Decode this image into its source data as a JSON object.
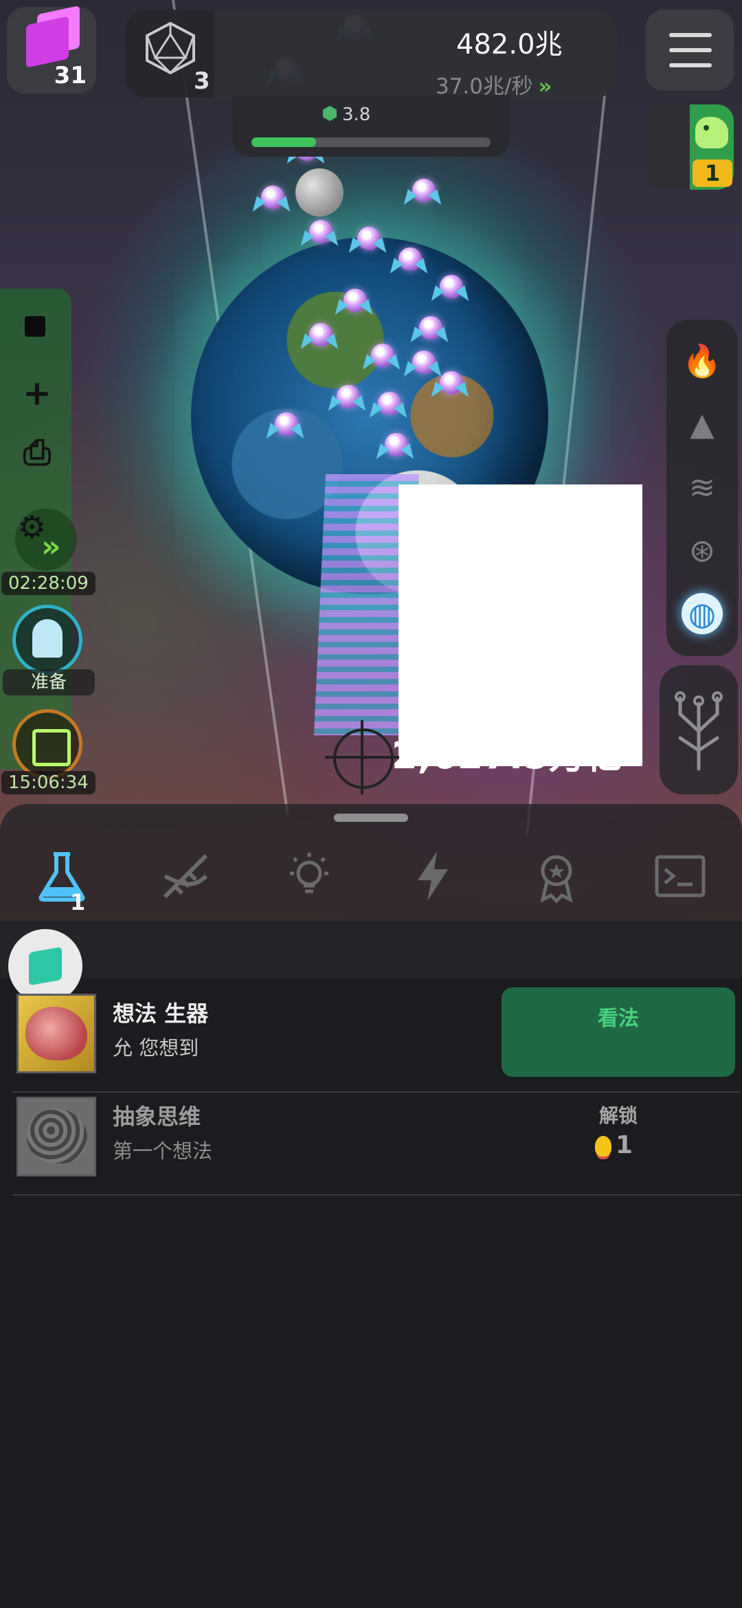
{
  "hud": {
    "cube_count": "31",
    "d20_count": "3",
    "resource_amount": "482.0兆",
    "resource_rate": "37.0兆/秒",
    "rate_icon": "double-chevron-right-icon",
    "gem_value": "3.8",
    "progress_fraction": 0.27,
    "dino_count": "1"
  },
  "left_rail": {
    "timer_1": "02:28:09",
    "ready_label": "准备",
    "timer_2": "15:06:34"
  },
  "right_rail": {
    "icons": [
      "fire-icon",
      "mountain-icon",
      "waves-icon",
      "cells-icon",
      "globe-icon",
      "tree-icon"
    ],
    "selected": "globe-icon"
  },
  "scene": {
    "damage_text": "2,627.5万亿"
  },
  "tabs": {
    "items": [
      "flask-icon",
      "dna-icon",
      "lightbulb-icon",
      "lightning-icon",
      "medal-icon",
      "terminal-icon"
    ],
    "active": "flask-icon",
    "flask_badge": "1"
  },
  "list": {
    "rows": [
      {
        "title": "想法 生器",
        "desc": "允 您想到",
        "action": "看法"
      },
      {
        "title": "抽象思维",
        "desc": "第一个想法",
        "action": "解锁",
        "cost": "1"
      }
    ]
  },
  "colors": {
    "accent_green": "#46d27d",
    "button_green": "#1f6a45",
    "background": "#1b1c1f",
    "selected_tab": "#4fc3f7"
  }
}
